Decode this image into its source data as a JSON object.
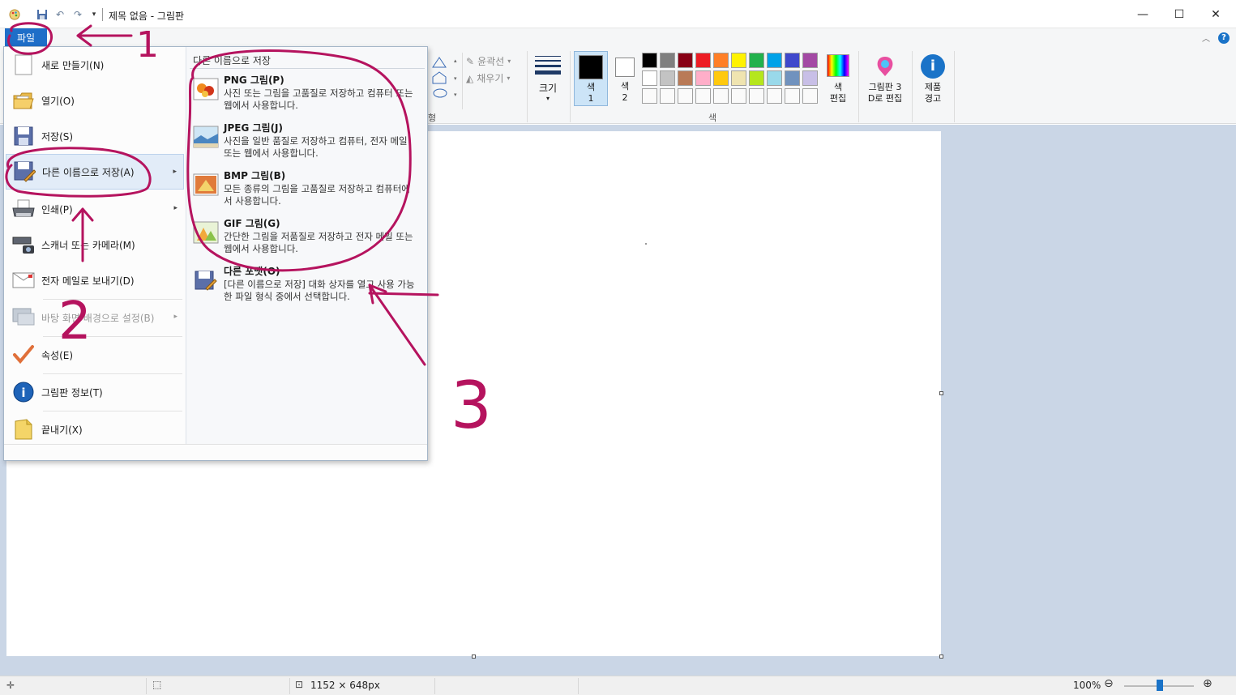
{
  "window": {
    "title": "제목 없음 - 그림판",
    "controls": {
      "minimize": "—",
      "maximize": "☐",
      "close": "✕"
    }
  },
  "file_tab": {
    "label": "파일"
  },
  "file_menu": {
    "items": [
      {
        "label": "새로 만들기(N)",
        "icon": "new-file-icon"
      },
      {
        "label": "열기(O)",
        "icon": "open-folder-icon"
      },
      {
        "label": "저장(S)",
        "icon": "save-icon"
      },
      {
        "label": "다른 이름으로 저장(A)",
        "icon": "save-as-icon",
        "highlighted": true
      },
      {
        "label": "인쇄(P)",
        "icon": "printer-icon"
      },
      {
        "label": "스캐너 또는 카메라(M)",
        "icon": "scanner-icon"
      },
      {
        "label": "전자 메일로 보내기(D)",
        "icon": "email-icon"
      },
      {
        "label": "바탕 화면 배경으로 설정(B)",
        "icon": "desktop-background-icon",
        "disabled": true
      },
      {
        "label": "속성(E)",
        "icon": "properties-check-icon"
      },
      {
        "label": "그림판 정보(T)",
        "icon": "info-icon"
      },
      {
        "label": "끝내기(X)",
        "icon": "exit-icon"
      }
    ]
  },
  "save_as_submenu": {
    "title": "다른 이름으로 저장",
    "items": [
      {
        "name": "PNG 그림(P)",
        "desc": "사진 또는 그림을 고품질로 저장하고 컴퓨터 또는 웹에서 사용합니다.",
        "icon": "png-image-icon"
      },
      {
        "name": "JPEG 그림(J)",
        "desc": "사진을 일반 품질로 저장하고 컴퓨터, 전자 메일 또는 웹에서 사용합니다.",
        "icon": "jpeg-image-icon"
      },
      {
        "name": "BMP 그림(B)",
        "desc": "모든 종류의 그림을 고품질로 저장하고 컴퓨터에서 사용합니다.",
        "icon": "bmp-image-icon"
      },
      {
        "name": "GIF 그림(G)",
        "desc": "간단한 그림을 저품질로 저장하고 전자 메일 또는 웹에서 사용합니다.",
        "icon": "gif-image-icon"
      },
      {
        "name": "다른 포맷(O)",
        "desc": "[다른 이름으로 저장] 대화 상자를 열고 사용 가능한 파일 형식 중에서 선택합니다.",
        "icon": "other-format-icon"
      }
    ]
  },
  "ribbon": {
    "shapes_group_label": "형",
    "outline_label": "윤곽선",
    "fill_label": "채우기",
    "size_label": "크기",
    "color1_label": "색\n1",
    "color2_label": "색\n2",
    "colors_group_label": "색",
    "edit_colors_label": "색\n편집",
    "paint3d_label": "그림판 3\nD로 편집",
    "product_alert_label": "제품\n경고",
    "palette_row1": [
      "#000000",
      "#7f7f7f",
      "#880015",
      "#ed1c24",
      "#ff7f27",
      "#fff200",
      "#22b14c",
      "#00a2e8",
      "#3f48cc",
      "#a349a4"
    ],
    "palette_row2": [
      "#ffffff",
      "#c3c3c3",
      "#b97a57",
      "#ffaec9",
      "#ffc90e",
      "#efe4b0",
      "#b5e61d",
      "#99d9ea",
      "#7092be",
      "#c8bfe7"
    ],
    "color1": "#000000",
    "color2": "#ffffff"
  },
  "statusbar": {
    "canvas_size": "1152 × 648px",
    "zoom": "100%"
  },
  "annotations": {
    "number1": "1",
    "number2": "2",
    "number3": "3",
    "ink_color": "#b5135e"
  }
}
